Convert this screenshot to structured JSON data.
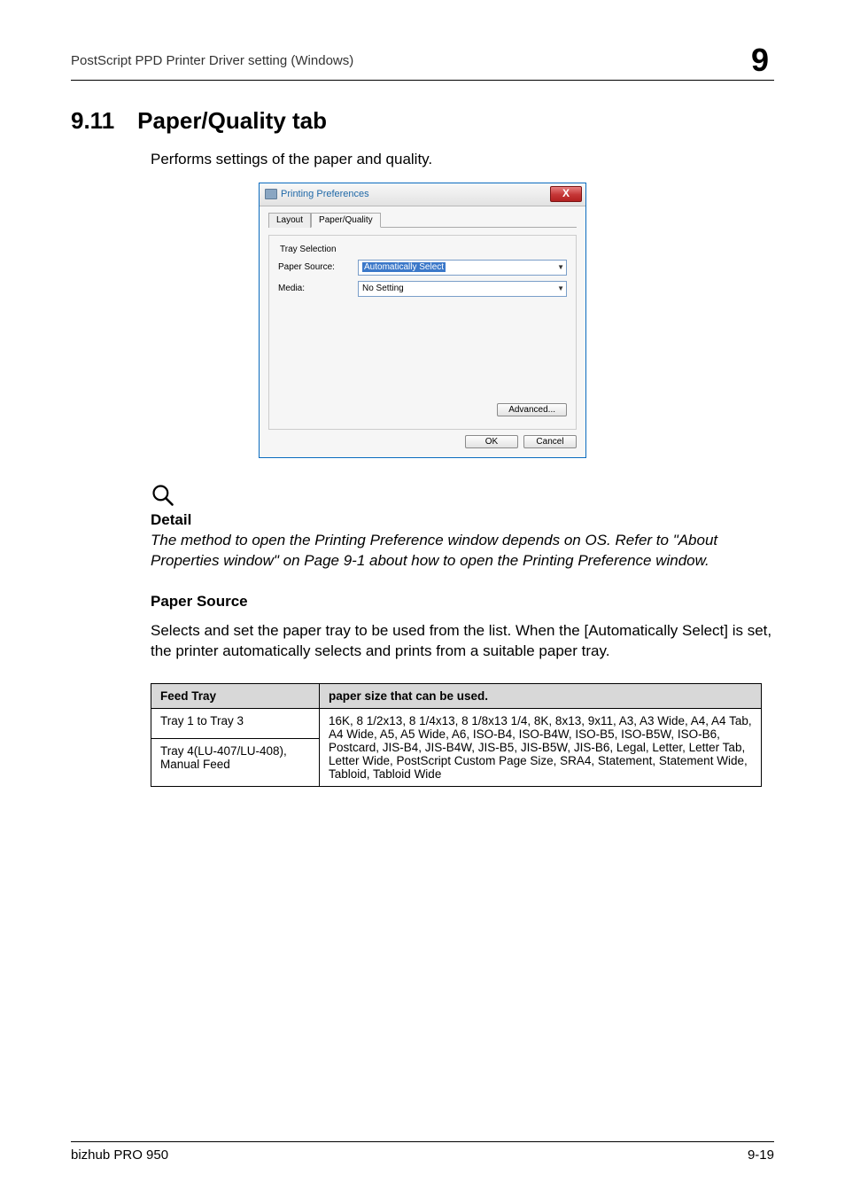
{
  "header": {
    "doc_title": "PostScript PPD Printer Driver setting (Windows)",
    "chapter": "9"
  },
  "section": {
    "number": "9.11",
    "title": "Paper/Quality tab",
    "intro": "Performs settings of the paper and quality."
  },
  "dialog": {
    "window_title": "Printing Preferences",
    "close_glyph": "X",
    "tabs": {
      "layout": "Layout",
      "paper_quality": "Paper/Quality"
    },
    "group_legend": "Tray Selection",
    "paper_source_label": "Paper Source:",
    "paper_source_value": "Automatically Select",
    "media_label": "Media:",
    "media_value": "No Setting",
    "advanced_btn": "Advanced...",
    "ok_btn": "OK",
    "cancel_btn": "Cancel"
  },
  "detail": {
    "heading": "Detail",
    "text": "The method to open the Printing Preference window depends on OS. Refer to \"About Properties window\" on Page 9-1 about how to open the Printing Preference window."
  },
  "paper_source": {
    "heading": "Paper Source",
    "text": "Selects and set the paper tray to be used from the list. When the [Automatically Select] is set, the printer automatically selects and prints from a suitable paper tray."
  },
  "table": {
    "head_feed": "Feed Tray",
    "head_size": "paper size that can be used.",
    "row1_feed": "Tray 1 to Tray 3",
    "row1_size": "16K, 8 1/2x13, 8 1/4x13, 8 1/8x13 1/4, 8K, 8x13, 9x11, A3, A3 Wide, A4, A4 Tab, A4 Wide, A5, A5 Wide, A6, ISO-B4, ISO-B4W, ISO-B5, ISO-B5W, ISO-B6, Postcard, JIS-B4, JIS-B4W, JIS-B5, JIS-B5W, JIS-B6, Legal, Letter, Letter Tab, Letter Wide, PostScript Custom Page Size, SRA4, Statement, Statement Wide, Tabloid, Tabloid Wide",
    "row2_feed": "Tray 4(LU-407/LU-408), Manual Feed"
  },
  "footer": {
    "product": "bizhub PRO 950",
    "page": "9-19"
  }
}
